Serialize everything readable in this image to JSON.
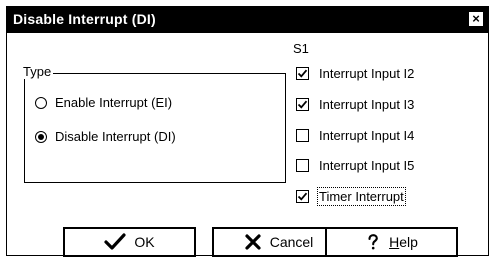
{
  "window": {
    "title": "Disable Interrupt (DI)",
    "close_glyph": "×"
  },
  "type_group": {
    "label": "Type",
    "options": [
      {
        "label": "Enable Interrupt (EI)",
        "selected": false
      },
      {
        "label": "Disable Interrupt (DI)",
        "selected": true
      }
    ]
  },
  "s1_group": {
    "label": "S1",
    "items": [
      {
        "label": "Interrupt Input I2",
        "checked": true
      },
      {
        "label": "Interrupt Input I3",
        "checked": true
      },
      {
        "label": "Interrupt Input I4",
        "checked": false
      },
      {
        "label": "Interrupt Input I5",
        "checked": false
      },
      {
        "label": "Timer Interrupt",
        "checked": true,
        "focused": true
      }
    ]
  },
  "buttons": {
    "ok": {
      "label": "OK",
      "icon": "checkmark-icon"
    },
    "cancel": {
      "label": "Cancel",
      "icon": "x-icon"
    },
    "help": {
      "label_prefix": "",
      "label_underlined": "H",
      "label_suffix": "elp",
      "icon": "question-icon"
    }
  }
}
